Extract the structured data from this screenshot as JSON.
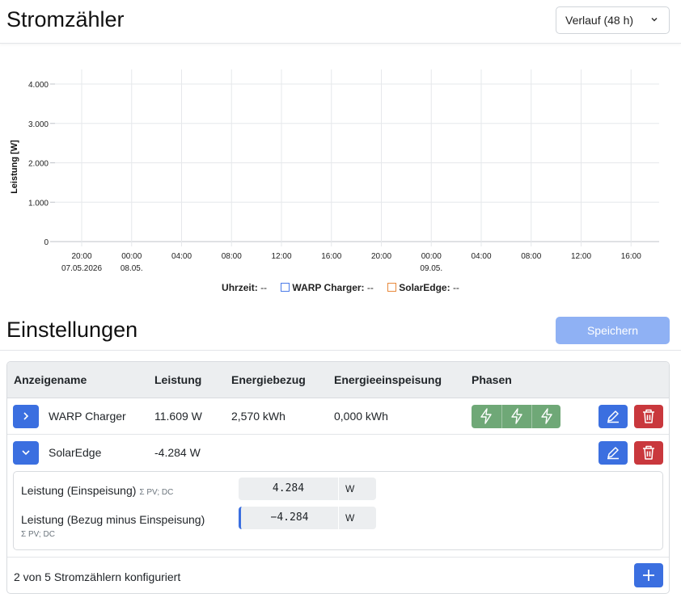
{
  "header": {
    "title": "Stromzähler",
    "view_select": {
      "selected": "Verlauf (48 h)"
    }
  },
  "chart_data": {
    "type": "line",
    "ylabel": "Leistung [W]",
    "y_ticks": [
      "4.000",
      "3.000",
      "2.000",
      "1.000",
      "0"
    ],
    "ylim": [
      0,
      4000
    ],
    "x_ticks": [
      {
        "time": "20:00",
        "date": "07.05.2026"
      },
      {
        "time": "00:00",
        "date": "08.05."
      },
      {
        "time": "04:00",
        "date": ""
      },
      {
        "time": "08:00",
        "date": ""
      },
      {
        "time": "12:00",
        "date": ""
      },
      {
        "time": "16:00",
        "date": ""
      },
      {
        "time": "20:00",
        "date": ""
      },
      {
        "time": "00:00",
        "date": "09.05."
      },
      {
        "time": "04:00",
        "date": ""
      },
      {
        "time": "08:00",
        "date": ""
      },
      {
        "time": "12:00",
        "date": ""
      },
      {
        "time": "16:00",
        "date": ""
      }
    ],
    "grid": true,
    "series": [
      {
        "name": "WARP Charger",
        "value": "--",
        "color": "#4b7be8"
      },
      {
        "name": "SolarEdge",
        "value": "--",
        "color": "#e8893b"
      }
    ],
    "legend": {
      "time_label": "Uhrzeit:",
      "time_value": "--"
    }
  },
  "settings": {
    "title": "Einstellungen",
    "save_label": "Speichern"
  },
  "table": {
    "columns": [
      "Anzeigename",
      "Leistung",
      "Energiebezug",
      "Energieeinspeisung",
      "Phasen"
    ],
    "rows": [
      {
        "name": "WARP Charger",
        "power": "11.609 W",
        "import": "2,570 kWh",
        "export": "0,000 kWh",
        "expanded": false,
        "phases_active": 3
      },
      {
        "name": "SolarEdge",
        "power": "-4.284 W",
        "import": "",
        "export": "",
        "expanded": true
      }
    ],
    "details": [
      {
        "label": "Leistung (Einspeisung)",
        "hint": "Σ PV; DC",
        "value": "4.284",
        "unit": "W"
      },
      {
        "label": "Leistung (Bezug minus Einspeisung)",
        "hint": "Σ PV; DC",
        "value": "−4.284",
        "unit": "W"
      }
    ],
    "footer": "2 von 5 Stromzählern konfiguriert"
  },
  "colors": {
    "primary": "#3b6fe0",
    "danger": "#c9383d",
    "success": "#6fa877",
    "save_disabled": "#8fb1f4"
  }
}
